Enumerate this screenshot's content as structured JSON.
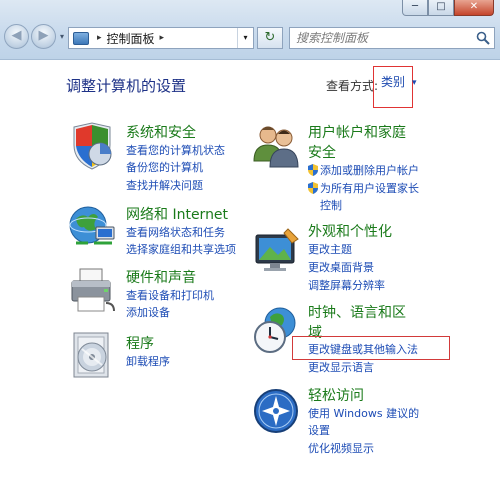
{
  "window": {
    "minimize_label": "─",
    "maximize_label": "□",
    "close_label": "✕"
  },
  "nav": {
    "back_label": "◀",
    "forward_label": "▶",
    "dropdown_label": "▾"
  },
  "address": {
    "separator": "▸",
    "path": "控制面板",
    "trailing_separator": "▸",
    "dropdown": "▾"
  },
  "refresh_label": "↻",
  "search": {
    "placeholder": "搜索控制面板"
  },
  "main": {
    "title": "调整计算机的设置",
    "view_by_label": "查看方式:",
    "view_by_value": "类别",
    "view_by_dropdown": "▾"
  },
  "categories_left": [
    {
      "title": "系统和安全",
      "links": [
        "查看您的计算机状态",
        "备份您的计算机",
        "查找并解决问题"
      ]
    },
    {
      "title": "网络和 Internet",
      "links": [
        "查看网络状态和任务",
        "选择家庭组和共享选项"
      ]
    },
    {
      "title": "硬件和声音",
      "links": [
        "查看设备和打印机",
        "添加设备"
      ]
    },
    {
      "title": "程序",
      "links": [
        "卸载程序"
      ]
    }
  ],
  "categories_right": [
    {
      "title_line1": "用户帐户和家庭",
      "title_line2": "安全",
      "links": [
        "添加或删除用户帐户",
        "为所有用户设置家长",
        "控制"
      ]
    },
    {
      "title": "外观和个性化",
      "links": [
        "更改主题",
        "更改桌面背景",
        "调整屏幕分辨率"
      ]
    },
    {
      "title_line1": "时钟、语言和区",
      "title_line2": "域",
      "links": [
        "更改键盘或其他输入法",
        "更改显示语言"
      ]
    },
    {
      "title": "轻松访问",
      "links": [
        "使用 Windows 建议的",
        "设置",
        "优化视频显示"
      ]
    }
  ]
}
